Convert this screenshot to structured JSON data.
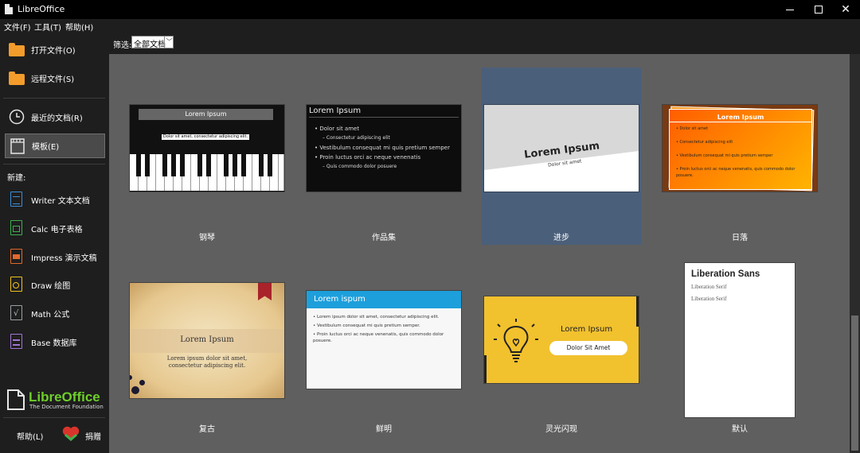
{
  "window": {
    "title": "LibreOffice"
  },
  "menu": {
    "file": "文件(F)",
    "tools": "工具(T)",
    "help": "帮助(H)"
  },
  "sidebar": {
    "open_file": "打开文件(O)",
    "remote_files": "远程文件(S)",
    "recent_docs": "最近的文档(R)",
    "templates": "模板(E)",
    "new_label": "新建:",
    "writer": "Writer 文本文档",
    "calc": "Calc 电子表格",
    "impress": "Impress 演示文稿",
    "draw": "Draw 绘图",
    "math": "Math 公式",
    "base": "Base 数据库",
    "logo_name": "LibreOffice",
    "logo_sub": "The Document Foundation",
    "help_button": "帮助(L)",
    "donate_button": "捐赠"
  },
  "filter": {
    "label": "筛选:",
    "value": "全部文档"
  },
  "templates": [
    {
      "name": "钢琴",
      "title": "Lorem Ipsum",
      "subtitle": "Dolor sit amet, consectetur adipiscing elit."
    },
    {
      "name": "作品集",
      "title": "Lorem Ipsum",
      "bullets": [
        "Dolor sit amet",
        "Consectetur adipiscing elit",
        "Vestibulum consequat mi quis pretium semper",
        "Proin luctus orci ac neque venenatis",
        "Quis commodo dolor posuere"
      ]
    },
    {
      "name": "进步",
      "title": "Lorem Ipsum",
      "subtitle": "Dolor sit amet"
    },
    {
      "name": "日落",
      "title": "Lorem Ipsum",
      "bullets": [
        "Dolor sit amet",
        "Consectetur adipiscing elit",
        "Vestibulum consequat mi quis pretium semper",
        "Proin luctus orci ac neque venenatis, quis commodo dolor posuere."
      ]
    },
    {
      "name": "复古",
      "title": "Lorem Ipsum",
      "subtitle_line1": "Lorem ipsum dolor sit amet,",
      "subtitle_line2": "consectetur adipiscing elit."
    },
    {
      "name": "鲜明",
      "title": "Lorem ispum",
      "bullets": [
        "Lorem ipsum dolor sit amet, consectetur adipiscing elit.",
        "Vestibulum consequat mi quis pretium semper.",
        "Proin luctus orci ac neque venenatis, quis commodo dolor posuere."
      ]
    },
    {
      "name": "灵光闪现",
      "title": "Lorem Ipsum",
      "button": "Dolor Sit Amet"
    },
    {
      "name": "默认",
      "heading": "Liberation Sans",
      "line1": "Liberation Serif",
      "line2": "Liberation Serif"
    }
  ],
  "colors": {
    "accent_selected": "#4a5f7a",
    "logo_green": "#6ecf2b",
    "folder_orange": "#f39c2c"
  }
}
